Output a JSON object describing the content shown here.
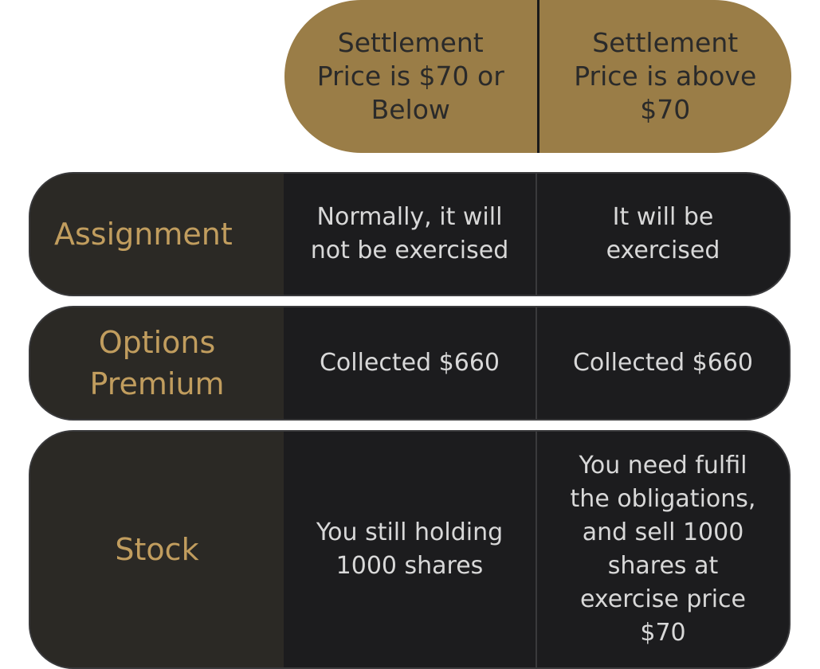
{
  "header": {
    "col1": "Settlement\nPrice is $70 or\nBelow",
    "col2": "Settlement\nPrice is above\n$70"
  },
  "rows": [
    {
      "label": "Assignment",
      "col1": "Normally, it will\nnot be exercised",
      "col2": "It will be\nexercised"
    },
    {
      "label": "Options\nPremium",
      "col1": "Collected $660",
      "col2": "Collected $660"
    },
    {
      "label": "Stock",
      "col1": "You still holding\n1000 shares",
      "col2": "You need fulfil\nthe obligations,\nand sell 1000\nshares at\nexercise price\n$70"
    }
  ],
  "colors": {
    "header_bg": "#9a7d47",
    "label_text": "#c19d5e",
    "row_bg": "#1c1c1e",
    "label_bg": "#2b2925"
  }
}
